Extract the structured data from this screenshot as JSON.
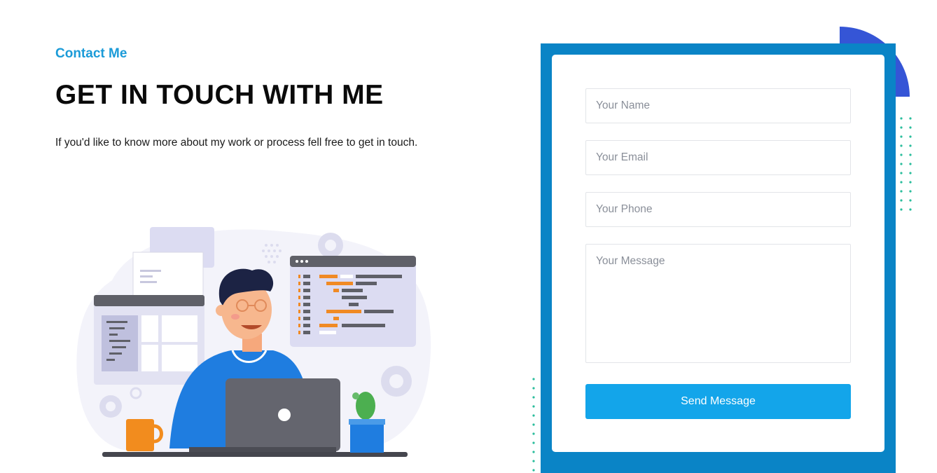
{
  "section": {
    "eyebrow": "Contact Me",
    "headline": "GET IN TOUCH WITH ME",
    "lead": "If you'd like to know more about my work or process fell free to get in touch."
  },
  "form": {
    "name_placeholder": "Your Name",
    "email_placeholder": "Your Email",
    "phone_placeholder": "Your Phone",
    "message_placeholder": "Your Message",
    "submit_label": "Send Message"
  },
  "colors": {
    "accent": "#1b9bd8",
    "panel_blue": "#0a84c6",
    "button_blue": "#13a5ea",
    "corner_shape": "#3555d6",
    "dots_teal": "#2bbd9c"
  },
  "illustration": {
    "subject": "developer-at-laptop-illustration"
  }
}
